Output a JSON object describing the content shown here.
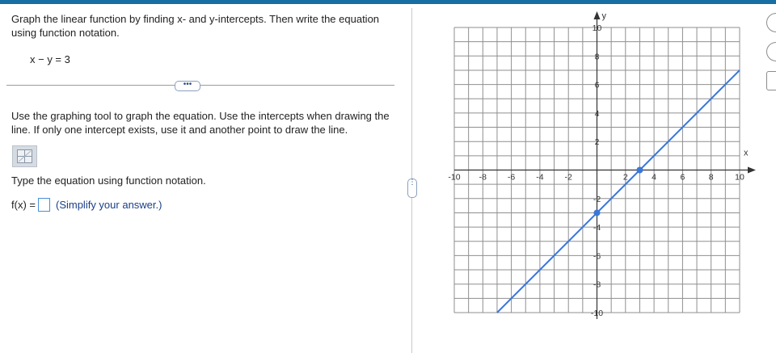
{
  "question": {
    "instructions": "Graph the linear function by finding x- and y-intercepts. Then write the equation using function notation.",
    "equation": "x − y = 3",
    "more_label": "•••",
    "graph_instructions": "Use the graphing tool to graph the equation. Use the intercepts when drawing the line. If only one intercept exists, use it and another point to draw the line.",
    "type_instructions": "Type the equation using function notation.",
    "answer_prefix": "f(x) =",
    "answer_value": "",
    "answer_hint": "(Simplify your answer.)"
  },
  "graph": {
    "x_axis_label": "x",
    "y_axis_label": "y",
    "xlim": [
      -10,
      10
    ],
    "ylim": [
      -10,
      10
    ],
    "grid": true,
    "x_tick_labels": [
      "-10",
      "-8",
      "-6",
      "-4",
      "-2",
      "2",
      "4",
      "6",
      "8",
      "10"
    ],
    "y_tick_labels": [
      "10",
      "8",
      "6",
      "4",
      "2",
      "-2",
      "-4",
      "-6",
      "-8",
      "-10"
    ],
    "line": {
      "slope": 1,
      "intercept": -3,
      "color": "#3a77d8"
    },
    "points": [
      {
        "x": 3,
        "y": 0
      },
      {
        "x": 0,
        "y": -3
      }
    ],
    "point_color": "#3a77d8"
  },
  "colors": {
    "top_bar": "#176ea3",
    "hint_text": "#1a3f87",
    "grid": "#8f8f8f"
  }
}
